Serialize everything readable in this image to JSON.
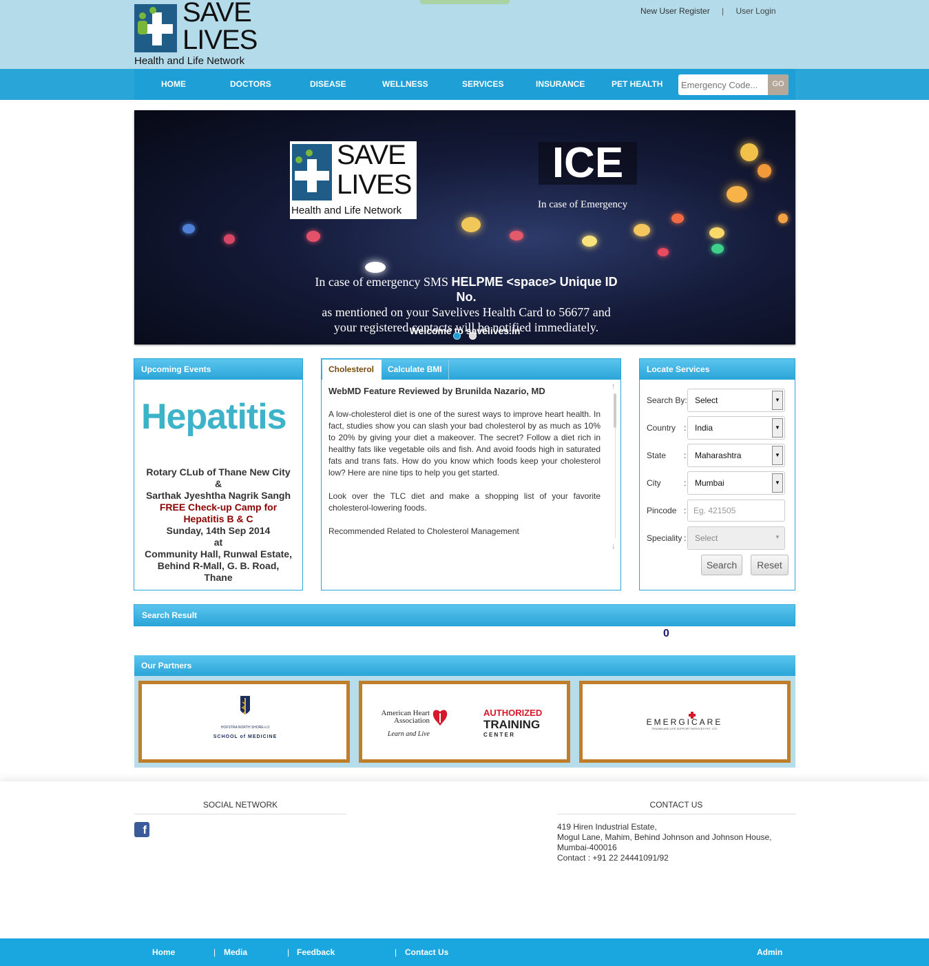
{
  "header": {
    "logo": {
      "line1": "SAVE",
      "line2": "LIVES",
      "tagline": "Health and Life Network"
    },
    "register_link": "New User Register",
    "separator": "|",
    "login_link": "User Login"
  },
  "nav": {
    "items": [
      "HOME",
      "DOCTORS",
      "DISEASE",
      "WELLNESS",
      "SERVICES",
      "INSURANCE",
      "PET HEALTH"
    ],
    "emergency_placeholder": "Emergency Code...",
    "go_label": "GO"
  },
  "banner": {
    "logo": {
      "line1": "SAVE",
      "line2": "LIVES",
      "tagline": "Health and Life Network"
    },
    "ice_title": "ICE",
    "ice_subtitle": "In case of Emergency",
    "sms_line1_pre": "In case of emergency SMS ",
    "sms_line1_bold": "HELPME <space> Unique ID No.",
    "sms_line2": "as mentioned on your Savelives Health Card to 56677 and",
    "sms_line3": "your registered contacts will be notified immediately.",
    "welcome": "Welcome to savelives.in",
    "active_slide": 1,
    "slide_count": 2
  },
  "events": {
    "title": "Upcoming Events",
    "image_text": "Hepatitis",
    "line1": "Rotary CLub of Thane New City",
    "line2": "&",
    "line3": "Sarthak Jyeshtha Nagrik Sangh",
    "line4": "FREE Check-up Camp for",
    "line5": "Hepatitis B & C",
    "line6": "Sunday, 14th Sep 2014",
    "line7": "at",
    "line8": "Community Hall, Runwal Estate,",
    "line9": "Behind R-Mall, G. B. Road,",
    "line10": "Thane"
  },
  "article": {
    "tabs": [
      "Cholesterol",
      "Calculate BMI"
    ],
    "heading": "WebMD Feature Reviewed by Brunilda Nazario, MD",
    "para1": "A low-cholesterol diet is one of the surest ways to improve heart health. In fact, studies show you can slash your bad cholesterol by as much as 10% to 20% by giving your diet a makeover. The secret? Follow a diet rich in healthy fats like vegetable oils and fish. And avoid foods high in saturated fats and trans fats. How do you know which foods keep your cholesterol low? Here are nine tips to help you get started.",
    "para2": "Look over the TLC diet and make a shopping list of your favorite cholesterol-lowering foods.",
    "para3": "Recommended Related to Cholesterol Management"
  },
  "locate": {
    "title": "Locate Services",
    "search_by_label": "Search By:",
    "search_by_value": "Select",
    "country_label": "Country",
    "country_value": "India",
    "state_label": "State",
    "state_value": "Maharashtra",
    "city_label": "City",
    "city_value": "Mumbai",
    "pincode_label": "Pincode",
    "pincode_placeholder": "Eg. 421505",
    "speciality_label": "Speciality",
    "speciality_value": "Select",
    "colon": ":",
    "search_button": "Search",
    "reset_button": "Reset"
  },
  "results": {
    "title": "Search Result",
    "count": "0"
  },
  "partners": {
    "title": "Our Partners",
    "p1_small": "HOFSTRA NORTH SHORE-LIJ",
    "p1_main": "SCHOOL of MEDICINE",
    "p2_org1": "American Heart",
    "p2_org2": "Association",
    "p2_slogan": "Learn and Live",
    "p2_auth": "AUTHORIZED",
    "p2_training": "TRAINING",
    "p2_center": "C E N T E R",
    "p3_name": "EMERGICARE",
    "p3_sub": "TRAUMA AND LIFE SUPPORT SERVICES PVT. LTD."
  },
  "footer": {
    "social_title": "SOCIAL NETWORK",
    "facebook_glyph": "f",
    "contact_title": "CONTACT US",
    "addr1": "419 Hiren Industrial Estate,",
    "addr2": "Mogul Lane, Mahim, Behind Johnson and Johnson House,",
    "addr3": "Mumbai-400016",
    "addr4": "Contact : +91 22 24441091/92"
  },
  "bottom_nav": {
    "home": "Home",
    "media": "Media",
    "feedback": "Feedback",
    "contact": "Contact Us",
    "admin": "Admin",
    "separator": "|"
  },
  "colors": {
    "header_bg": "#b3dbe9",
    "nav_bg": "#1e9fd6",
    "partner_border": "#c07d2a",
    "event_red": "#8b0000",
    "footer_bar": "#1aa7e0"
  }
}
